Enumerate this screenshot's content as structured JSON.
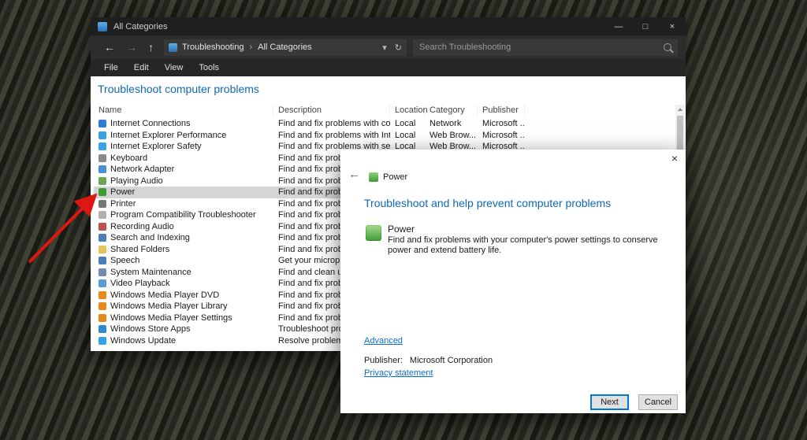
{
  "theme": {
    "titlebar_bg": "#1f1f1f",
    "toolbar_bg": "#2d2d2d",
    "menubar_bg": "#262626",
    "accent_blue": "#1168b4",
    "link_blue": "#0b6cd0",
    "selection_gray": "#d5d5d5",
    "focus_border": "#0078d7",
    "arrow_red": "#de1713"
  },
  "explorer": {
    "titlebar": {
      "title": "All Categories",
      "minimize_glyph": "—",
      "maximize_glyph": "□",
      "close_glyph": "×"
    },
    "toolbar": {
      "back_glyph": "←",
      "forward_glyph": "→",
      "up_glyph": "↑",
      "chevron_glyph": "▾",
      "refresh_glyph": "↻",
      "breadcrumb": {
        "root": "Troubleshooting",
        "separator": "›",
        "current": "All Categories"
      },
      "search_placeholder": "Search Troubleshooting"
    },
    "menus": [
      "File",
      "Edit",
      "View",
      "Tools"
    ],
    "heading": "Troubleshoot computer problems",
    "columns": [
      "Name",
      "Description",
      "Location",
      "Category",
      "Publisher"
    ],
    "rows": [
      {
        "name": "Internet Connections",
        "description": "Find and fix problems with conne...",
        "location": "Local",
        "category": "Network",
        "publisher": "Microsoft ...",
        "icon": "globe-icon",
        "icon_color": "#2e7cd6"
      },
      {
        "name": "Internet Explorer Performance",
        "description": "Find and fix problems with Intern...",
        "location": "Local",
        "category": "Web Brow...",
        "publisher": "Microsoft ...",
        "icon": "internet-explorer-icon",
        "icon_color": "#35a3e8"
      },
      {
        "name": "Internet Explorer Safety",
        "description": "Find and fix problems with securi...",
        "location": "Local",
        "category": "Web Brow...",
        "publisher": "Microsoft ...",
        "icon": "internet-explorer-icon",
        "icon_color": "#35a3e8"
      },
      {
        "name": "Keyboard",
        "description": "Find and fix problem",
        "icon": "keyboard-icon",
        "icon_color": "#8a8a8a"
      },
      {
        "name": "Network Adapter",
        "description": "Find and fix problem",
        "icon": "network-adapter-icon",
        "icon_color": "#4a90d9"
      },
      {
        "name": "Playing Audio",
        "description": "Find and fix problem",
        "icon": "speaker-icon",
        "icon_color": "#6aa84f"
      },
      {
        "name": "Power",
        "description": "Find and fix problem",
        "selected": true,
        "icon": "power-icon",
        "icon_color": "#3f9c35"
      },
      {
        "name": "Printer",
        "description": "Find and fix problem",
        "icon": "printer-icon",
        "icon_color": "#777777"
      },
      {
        "name": "Program Compatibility Troubleshooter",
        "description": "Find and fix problem",
        "icon": "app-window-icon",
        "icon_color": "#b0b0b0"
      },
      {
        "name": "Recording Audio",
        "description": "Find and fix problem",
        "icon": "microphone-icon",
        "icon_color": "#c0504d"
      },
      {
        "name": "Search and Indexing",
        "description": "Find and fix problem",
        "icon": "search-icon",
        "icon_color": "#4a7ebb"
      },
      {
        "name": "Shared Folders",
        "description": "Find and fix problem",
        "icon": "folder-icon",
        "icon_color": "#e8c35a"
      },
      {
        "name": "Speech",
        "description": "Get your microphone",
        "icon": "speech-icon",
        "icon_color": "#4a7ebb"
      },
      {
        "name": "System Maintenance",
        "description": "Find and clean up un",
        "icon": "maintenance-icon",
        "icon_color": "#6f8bb5"
      },
      {
        "name": "Video Playback",
        "description": "Find and fix problem",
        "icon": "video-icon",
        "icon_color": "#5b9bd5"
      },
      {
        "name": "Windows Media Player DVD",
        "description": "Find and fix problem",
        "icon": "media-player-icon",
        "icon_color": "#e88a1a"
      },
      {
        "name": "Windows Media Player Library",
        "description": "Find and fix problem",
        "icon": "media-player-icon",
        "icon_color": "#e88a1a"
      },
      {
        "name": "Windows Media Player Settings",
        "description": "Find and fix problem",
        "icon": "media-player-icon",
        "icon_color": "#e88a1a"
      },
      {
        "name": "Windows Store Apps",
        "description": "Troubleshoot probler",
        "icon": "store-icon",
        "icon_color": "#2e8ad6"
      },
      {
        "name": "Windows Update",
        "description": "Resolve problems tha",
        "icon": "update-icon",
        "icon_color": "#35a3e8"
      }
    ]
  },
  "wizard": {
    "close_glyph": "×",
    "back_glyph": "←",
    "title": "Power",
    "heading": "Troubleshoot and help prevent computer problems",
    "item_title": "Power",
    "item_description": "Find and fix problems with your computer's power settings to conserve power and extend battery life.",
    "advanced_link": "Advanced",
    "publisher_label": "Publisher:",
    "publisher_value": "Microsoft Corporation",
    "privacy_link": "Privacy statement",
    "next_button": "Next",
    "cancel_button": "Cancel"
  }
}
